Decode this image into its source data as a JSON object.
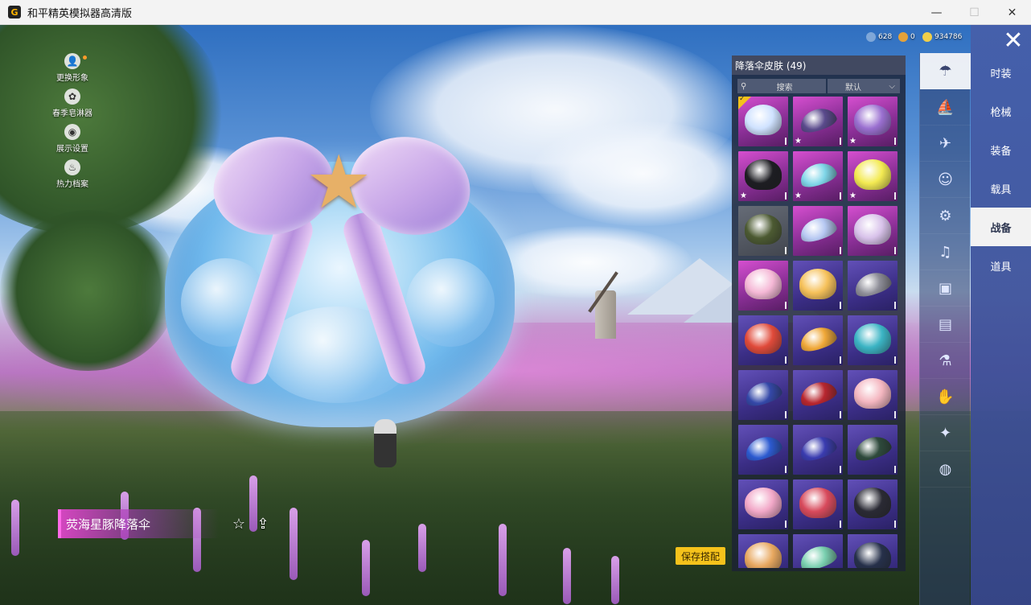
{
  "window": {
    "title": "和平精英模拟器高清版",
    "app_icon": "G",
    "minimize": "—",
    "maximize": "☐",
    "close": "✕"
  },
  "left_menu": [
    {
      "label": "更换形象",
      "icon": "person-icon",
      "glyph": "👤"
    },
    {
      "label": "春季皂淋器",
      "icon": "gear-icon",
      "glyph": "✿"
    },
    {
      "label": "展示设置",
      "icon": "eye-icon",
      "glyph": "◉"
    },
    {
      "label": "热力档案",
      "icon": "flame-icon",
      "glyph": "♨"
    }
  ],
  "currency": [
    {
      "value": "628",
      "color": "#7fa7d8"
    },
    {
      "value": "0",
      "color": "#e5a23a"
    },
    {
      "value": "934786",
      "color": "#f0cf4a"
    }
  ],
  "item": {
    "name": "荧海星豚降落伞",
    "favorite_icon": "☆",
    "share_icon": "⇪"
  },
  "save_button": "保存搭配",
  "panel": {
    "title": "降落伞皮肤 (49)",
    "search_placeholder": "搜索",
    "sort_value": "默认",
    "sort_arrow": "⌵",
    "search_glyph": "⚲"
  },
  "tiles": [
    {
      "rarity": "pink",
      "color": "#cfe2ff",
      "equipped": true,
      "star": false,
      "flat": false
    },
    {
      "rarity": "pink",
      "color": "#5a4a8c",
      "equipped": false,
      "star": true,
      "flat": true
    },
    {
      "rarity": "pink",
      "color": "#9a6fd0",
      "equipped": false,
      "star": true,
      "flat": false
    },
    {
      "rarity": "pink",
      "color": "#1d1d22",
      "equipped": false,
      "star": true,
      "flat": false
    },
    {
      "rarity": "pink",
      "color": "#7fd6e8",
      "equipped": false,
      "star": true,
      "flat": true
    },
    {
      "rarity": "pink",
      "color": "#f3ea52",
      "equipped": false,
      "star": true,
      "flat": false
    },
    {
      "rarity": "gray",
      "color": "#4c5a32",
      "equipped": false,
      "star": false,
      "flat": false
    },
    {
      "rarity": "pink",
      "color": "#b6c8f2",
      "equipped": false,
      "star": false,
      "flat": true
    },
    {
      "rarity": "pink",
      "color": "#d8c2ea",
      "equipped": false,
      "star": false,
      "flat": false
    },
    {
      "rarity": "pink",
      "color": "#f5b8d6",
      "equipped": false,
      "star": false,
      "flat": false
    },
    {
      "rarity": "purple",
      "color": "#f6c15a",
      "equipped": false,
      "star": false,
      "flat": false
    },
    {
      "rarity": "purple",
      "color": "#8e8e98",
      "equipped": false,
      "star": false,
      "flat": true
    },
    {
      "rarity": "purple",
      "color": "#e04a3a",
      "equipped": false,
      "star": false,
      "flat": false
    },
    {
      "rarity": "purple",
      "color": "#f0a838",
      "equipped": false,
      "star": false,
      "flat": true
    },
    {
      "rarity": "purple",
      "color": "#3bb4c4",
      "equipped": false,
      "star": false,
      "flat": false
    },
    {
      "rarity": "purple",
      "color": "#3448a8",
      "equipped": false,
      "star": false,
      "flat": true
    },
    {
      "rarity": "purple",
      "color": "#b8262e",
      "equipped": false,
      "star": false,
      "flat": true
    },
    {
      "rarity": "purple",
      "color": "#f4b6c0",
      "equipped": false,
      "star": false,
      "flat": false
    },
    {
      "rarity": "purple",
      "color": "#2c5ad0",
      "equipped": false,
      "star": false,
      "flat": true
    },
    {
      "rarity": "purple",
      "color": "#3a3cb0",
      "equipped": false,
      "star": false,
      "flat": true
    },
    {
      "rarity": "purple",
      "color": "#2e4a3c",
      "equipped": false,
      "star": false,
      "flat": true
    },
    {
      "rarity": "purple",
      "color": "#f2a8c8",
      "equipped": false,
      "star": false,
      "flat": false
    },
    {
      "rarity": "purple",
      "color": "#d84a5c",
      "equipped": false,
      "star": false,
      "flat": false
    },
    {
      "rarity": "purple",
      "color": "#2a2a34",
      "equipped": false,
      "star": false,
      "flat": false
    },
    {
      "rarity": "purple",
      "color": "#e8a860",
      "equipped": false,
      "star": false,
      "flat": false
    },
    {
      "rarity": "purple",
      "color": "#7ad0b0",
      "equipped": false,
      "star": false,
      "flat": true
    },
    {
      "rarity": "purple",
      "color": "#26304a",
      "equipped": false,
      "star": false,
      "flat": false
    }
  ],
  "rail": [
    {
      "icon": "parachute-icon",
      "glyph": "☂",
      "active": true
    },
    {
      "icon": "boat-icon",
      "glyph": "⛵",
      "active": false
    },
    {
      "icon": "airplane-icon",
      "glyph": "✈",
      "active": false
    },
    {
      "icon": "emote-icon",
      "glyph": "☺",
      "active": false
    },
    {
      "icon": "robot-icon",
      "glyph": "⚙",
      "active": false
    },
    {
      "icon": "speaker-icon",
      "glyph": "♫",
      "active": false
    },
    {
      "icon": "chat-icon",
      "glyph": "▣",
      "active": false
    },
    {
      "icon": "picture-icon",
      "glyph": "▤",
      "active": false
    },
    {
      "icon": "spray-icon",
      "glyph": "⚗",
      "active": false
    },
    {
      "icon": "hand-icon",
      "glyph": "✋",
      "active": false
    },
    {
      "icon": "magic-wand-icon",
      "glyph": "✦",
      "active": false
    },
    {
      "icon": "ufo-icon",
      "glyph": "◍",
      "active": false
    }
  ],
  "tabs": [
    {
      "label": "时装",
      "active": false
    },
    {
      "label": "枪械",
      "active": false
    },
    {
      "label": "装备",
      "active": false
    },
    {
      "label": "载具",
      "active": false
    },
    {
      "label": "战备",
      "active": true
    },
    {
      "label": "道具",
      "active": false
    }
  ],
  "close_panel": "✕"
}
